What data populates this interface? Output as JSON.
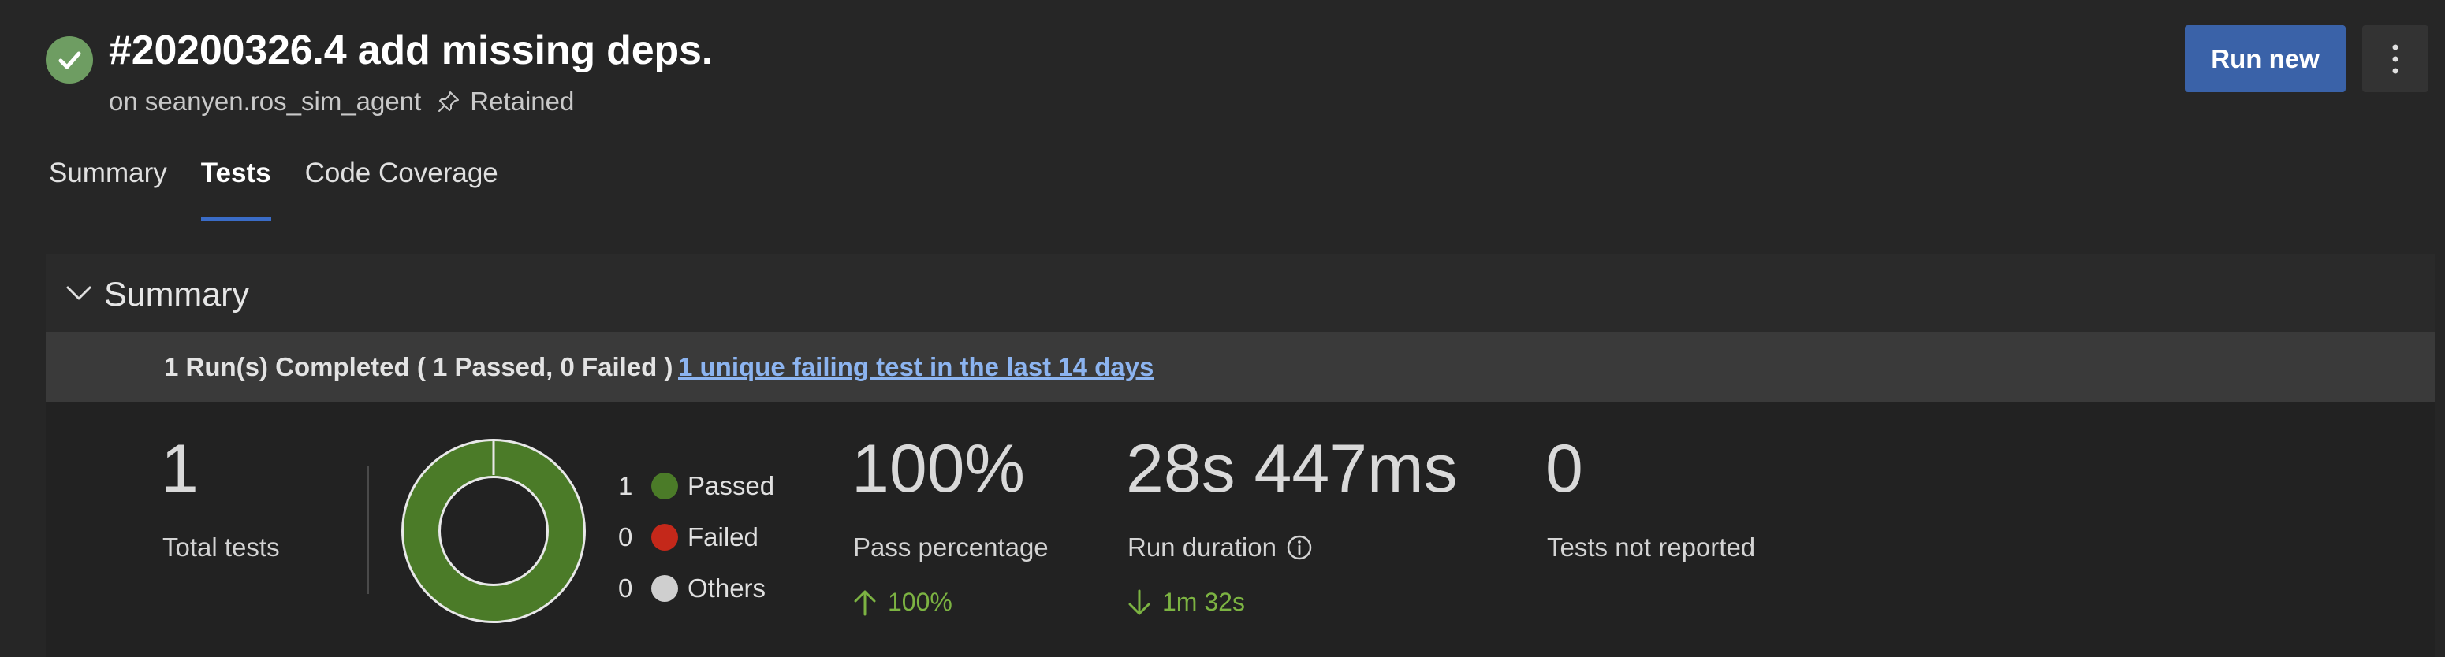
{
  "header": {
    "title": "#20200326.4 add missing deps.",
    "branch_line": "on seanyen.ros_sim_agent",
    "retained": "Retained",
    "run_new_label": "Run new",
    "status_icon": "check-icon",
    "status_color": "#6e9d62"
  },
  "tabs": [
    {
      "label": "Summary",
      "active": false
    },
    {
      "label": "Tests",
      "active": true
    },
    {
      "label": "Code Coverage",
      "active": false
    }
  ],
  "summary": {
    "section_title": "Summary",
    "runs_text": "1 Run(s) Completed ( 1 Passed, 0 Failed )",
    "failing_link": "1 unique failing test in the last 14 days",
    "total_tests": {
      "value": "1",
      "label": "Total tests"
    },
    "legend": [
      {
        "count": "1",
        "label": "Passed",
        "color": "#4b7b28"
      },
      {
        "count": "0",
        "label": "Failed",
        "color": "#c4281a"
      },
      {
        "count": "0",
        "label": "Others",
        "color": "#cfcfcf"
      }
    ],
    "donut": {
      "passed": 1,
      "failed": 0,
      "others": 0
    },
    "pass_percentage": {
      "value": "100%",
      "label": "Pass percentage",
      "trend": "100%",
      "trend_direction": "up"
    },
    "run_duration": {
      "value": "28s 447ms",
      "label": "Run duration",
      "trend": "1m 32s",
      "trend_direction": "down"
    },
    "not_reported": {
      "value": "0",
      "label": "Tests not reported"
    },
    "trend_color": "#7cb342",
    "accent_color": "#3a62a8"
  }
}
